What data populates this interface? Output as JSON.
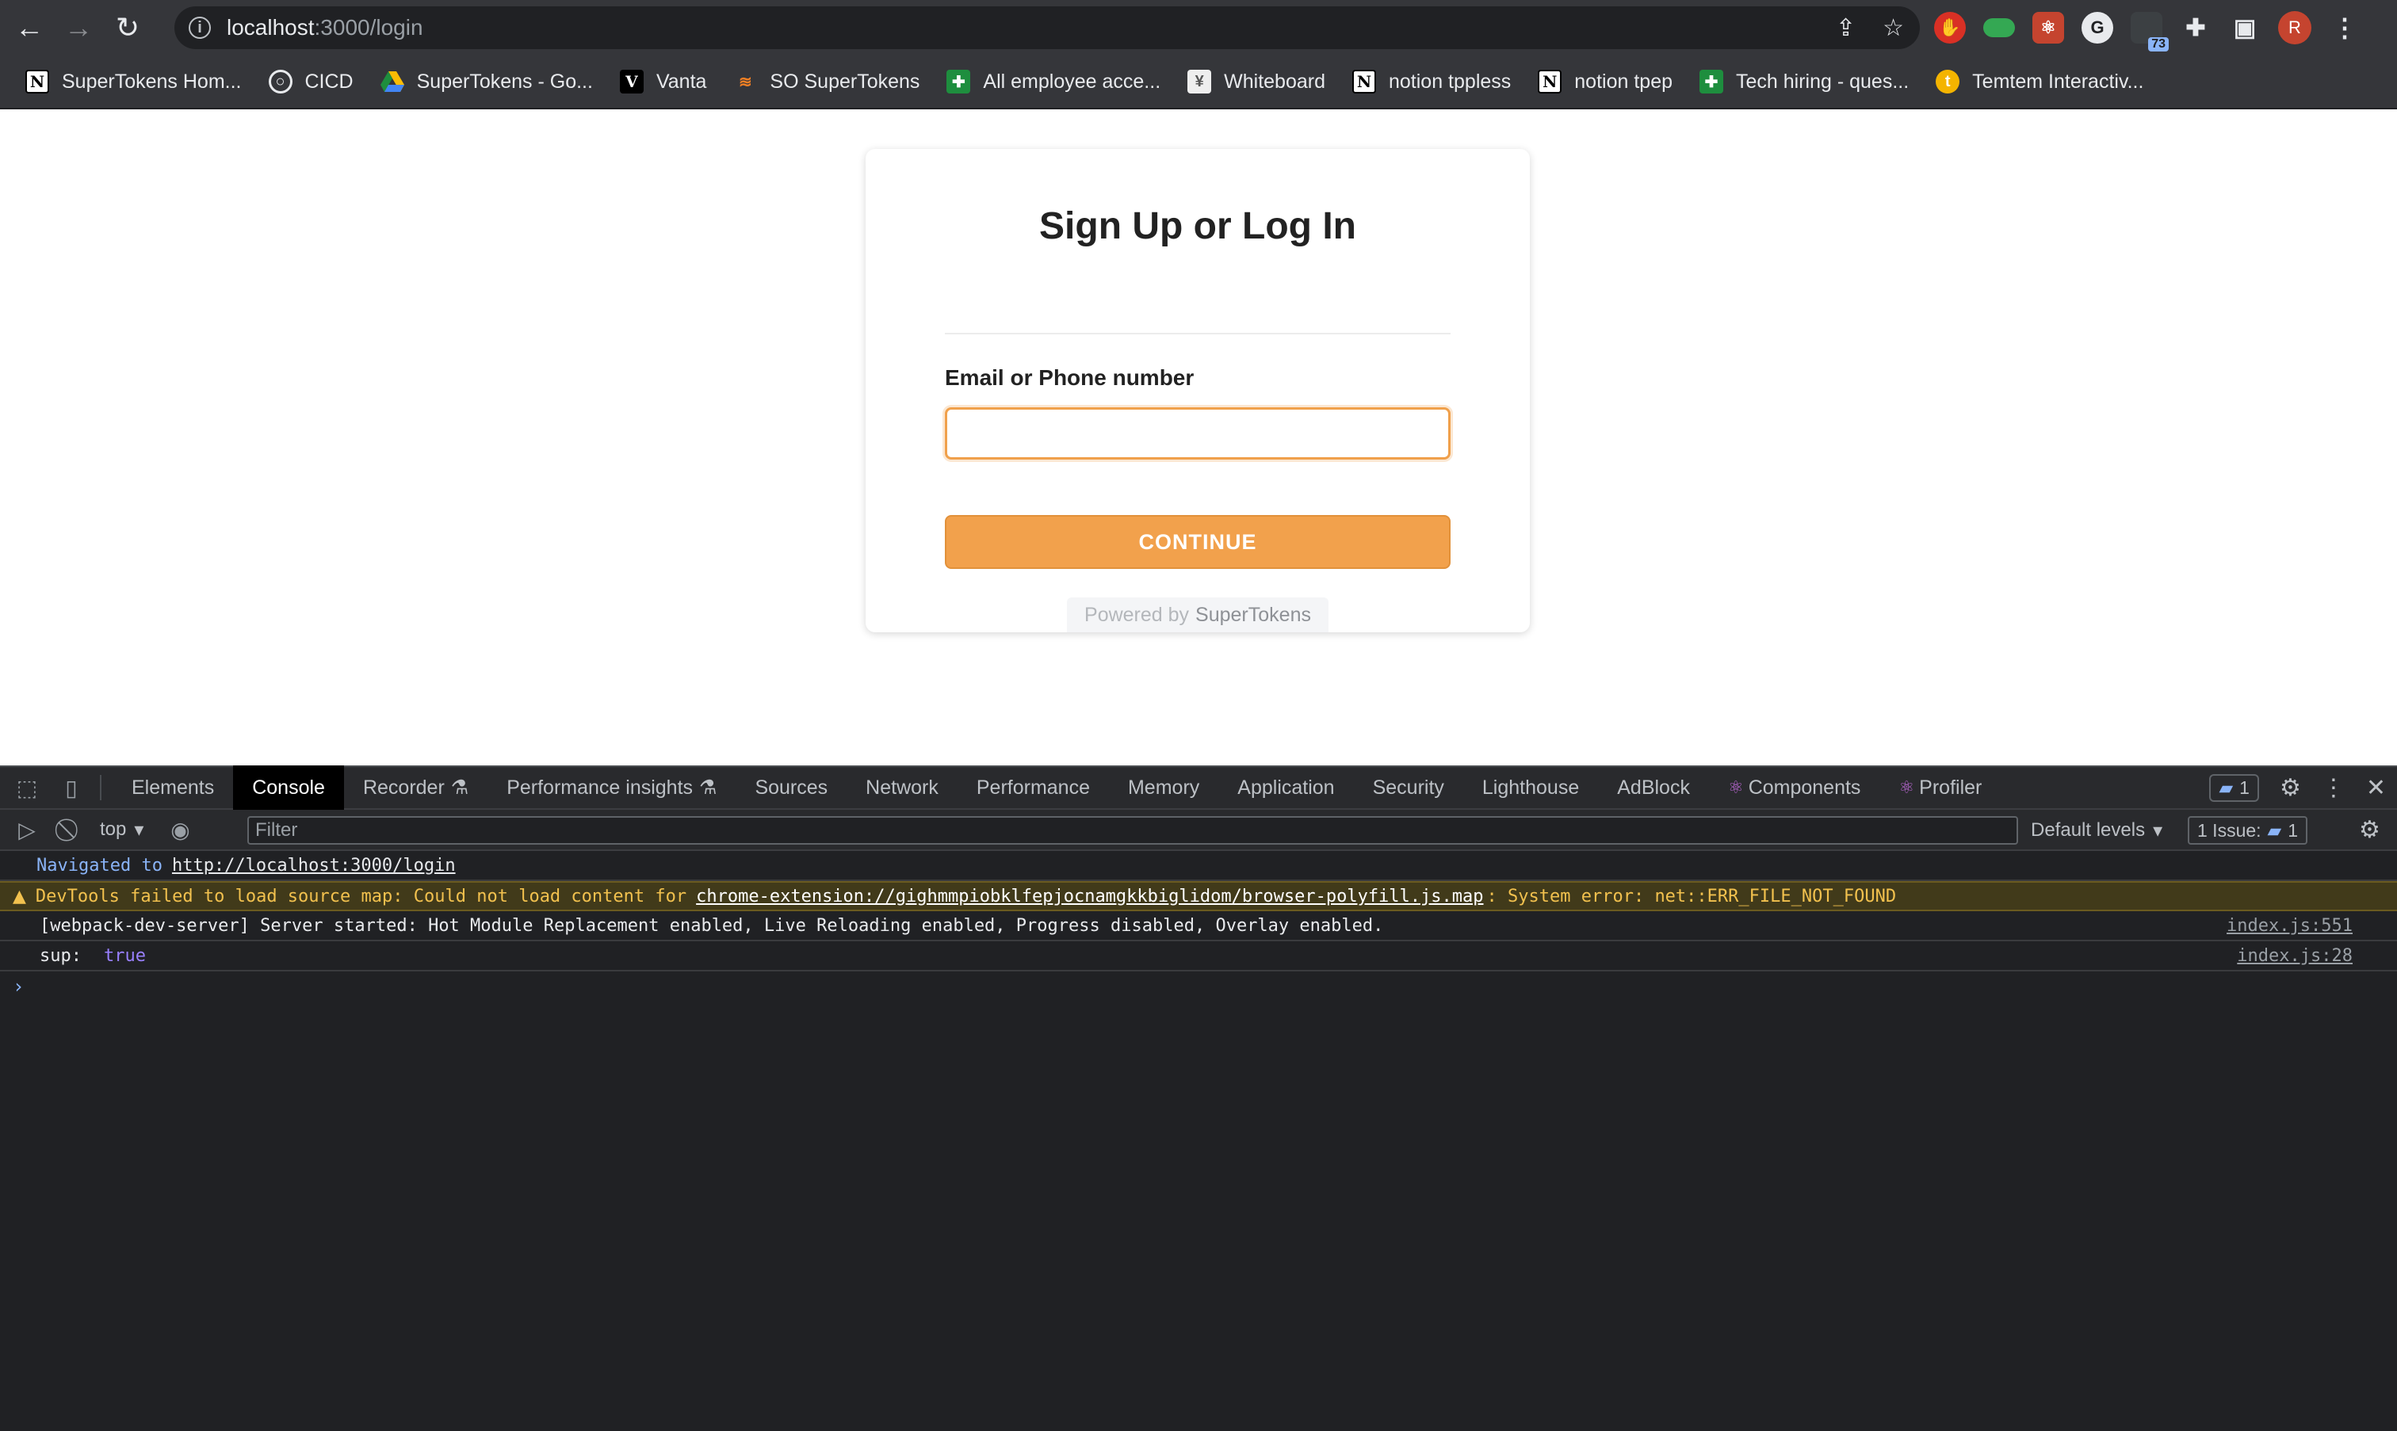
{
  "browser": {
    "url_host": "localhost",
    "url_rest": ":3000/login",
    "extension_badge": "73",
    "profile_initial": "R"
  },
  "bookmarks": [
    {
      "label": "SuperTokens Hom...",
      "icon": "notion-icon"
    },
    {
      "label": "CICD",
      "icon": "cicd-icon"
    },
    {
      "label": "SuperTokens - Go...",
      "icon": "drive-icon"
    },
    {
      "label": "Vanta",
      "icon": "vanta-icon"
    },
    {
      "label": "SO SuperTokens",
      "icon": "stackoverflow-icon"
    },
    {
      "label": "All employee acce...",
      "icon": "sheets-icon"
    },
    {
      "label": "Whiteboard",
      "icon": "whiteboard-icon"
    },
    {
      "label": "notion tppless",
      "icon": "notion-icon"
    },
    {
      "label": "notion tpep",
      "icon": "notion-icon"
    },
    {
      "label": "Tech hiring - ques...",
      "icon": "sheets-icon"
    },
    {
      "label": "Temtem Interactiv...",
      "icon": "temtem-icon"
    }
  ],
  "login": {
    "title": "Sign Up or Log In",
    "field_label": "Email or Phone number",
    "input_value": "",
    "button_label": "CONTINUE",
    "powered_by": "Powered by",
    "brand": "SuperTokens",
    "accent_color": "#f2a14c"
  },
  "devtools": {
    "tabs": [
      "Elements",
      "Console",
      "Recorder",
      "Performance insights",
      "Sources",
      "Network",
      "Performance",
      "Memory",
      "Application",
      "Security",
      "Lighthouse",
      "AdBlock",
      "Components",
      "Profiler"
    ],
    "active_tab": "Console",
    "message_count": "1",
    "context": "top",
    "filter_placeholder": "Filter",
    "levels": "Default levels",
    "issues_label": "1 Issue:",
    "issues_count": "1",
    "console": {
      "nav_text": "Navigated to",
      "nav_url": "http://localhost:3000/login",
      "warn_prefix": "DevTools failed to load source map: Could not load content for",
      "warn_link": "chrome-extension://gighmmpiobklfepjocnamgkkbiglidom/browser-polyfill.js.map",
      "warn_suffix": ": System error: net::ERR_FILE_NOT_FOUND",
      "log1_text": "[webpack-dev-server] Server started: Hot Module Replacement enabled, Live Reloading enabled, Progress disabled, Overlay enabled.",
      "log1_src": "index.js:551",
      "log2_key": "sup:",
      "log2_val": "true",
      "log2_src": "index.js:28",
      "prompt": "›"
    }
  }
}
